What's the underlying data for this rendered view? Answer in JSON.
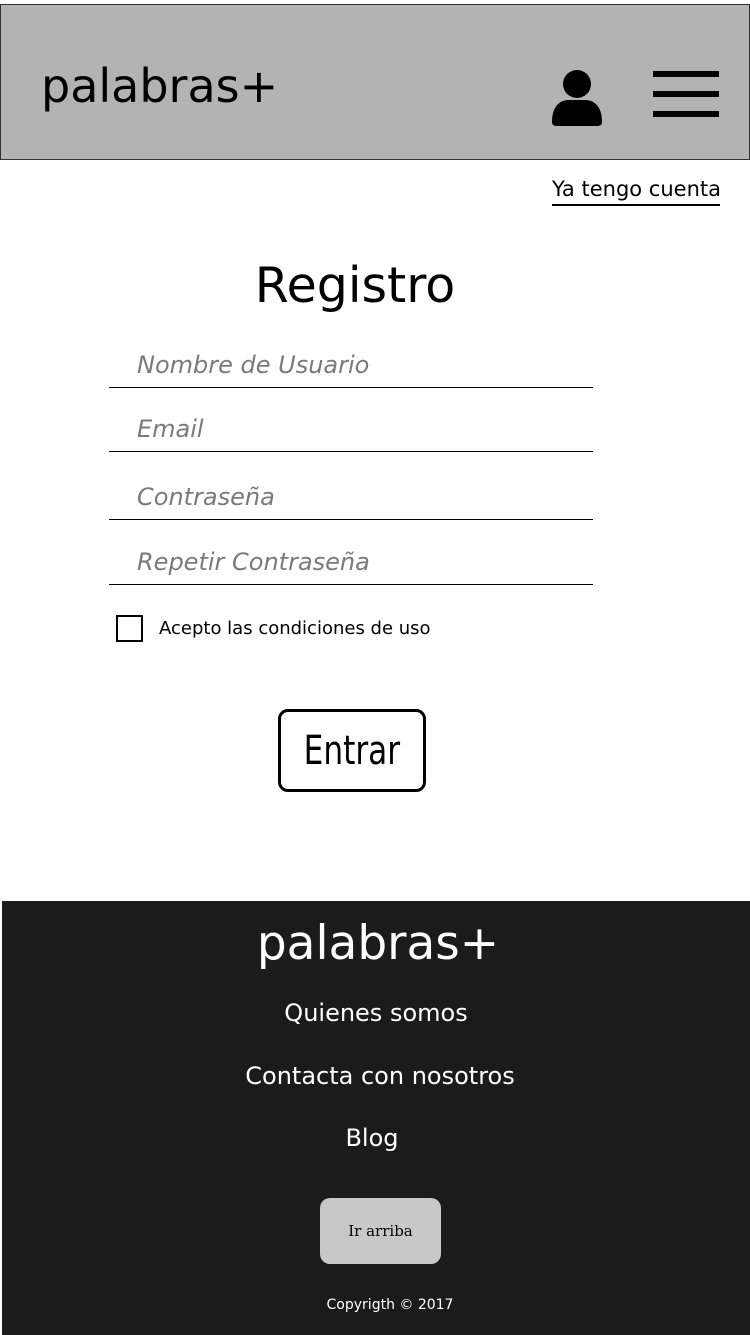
{
  "header": {
    "logo": "palabras+",
    "icons": {
      "user": "user-icon",
      "menu": "hamburger-menu-icon"
    }
  },
  "account": {
    "login_link": "Ya tengo cuenta"
  },
  "form": {
    "title": "Registro",
    "fields": [
      {
        "placeholder": "Nombre de Usuario",
        "value": ""
      },
      {
        "placeholder": "Email",
        "value": ""
      },
      {
        "placeholder": "Contraseña",
        "value": ""
      },
      {
        "placeholder": "Repetir Contraseña",
        "value": ""
      }
    ],
    "terms": {
      "label": "Acepto las condiciones de uso",
      "checked": false
    },
    "submit_label": "Entrar"
  },
  "footer": {
    "logo": "palabras+",
    "links": [
      "Quienes somos",
      "Contacta con nosotros",
      "Blog"
    ],
    "back_to_top": "Ir arriba",
    "copyright": "Copyrigth © 2017"
  },
  "colors": {
    "header_bg": "#b3b3b3",
    "footer_bg": "#1b1b1b",
    "top_button_bg": "#c8c8c8"
  }
}
